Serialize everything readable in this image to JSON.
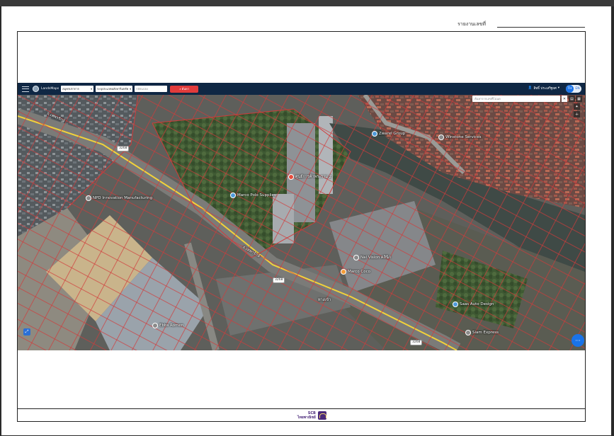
{
  "report": {
    "label": "รายงานเลขที่",
    "value": ""
  },
  "nav": {
    "brand": "LandsMaps",
    "province_value": "สมุทรปราการ",
    "district_value": "ระบุประเภทอสังหาริมทรัพย์",
    "parcel_placeholder": "รหัสแปลง",
    "search_label": "ค้นหา",
    "user_name": "สิทธิ์ ประเสริฐยศ",
    "lang": [
      "TH",
      "EN"
    ]
  },
  "map_search": {
    "placeholder": "ค้นหาจากเลขที่โฉนด"
  },
  "places": [
    {
      "name": "Marco Polo Supplies",
      "color": "#4e9ad9"
    },
    {
      "name": "ศูนย์การค้าพระราม 2",
      "color": "#e74c3c"
    },
    {
      "name": "NPD Innovation Manufacturing",
      "color": "#8a8a8a"
    },
    {
      "name": "Zwarel Group",
      "color": "#4e9ad9"
    },
    {
      "name": "Winstone Services",
      "color": "#8a8a8a"
    },
    {
      "name": "Ebbs Romen",
      "color": "#8a8a8a"
    },
    {
      "name": "Saas Auto Design",
      "color": "#4e9ad9"
    },
    {
      "name": "Siam Express",
      "color": "#8a8a8a"
    },
    {
      "name": "Nai Vision คลินิก",
      "color": "#8a8a8a"
    },
    {
      "name": "Marco Coco",
      "color": "#f39c37"
    }
  ],
  "roads": [
    {
      "label": "ถ.เทพารักษ์"
    },
    {
      "label": "ถ.เทพารักษ์"
    },
    {
      "label": "ทางเข้า"
    }
  ],
  "shields": [
    "3268",
    "3268",
    "3268"
  ],
  "footer": {
    "bank_line1": "SCB",
    "bank_line2": "ไทยพาณิชย์"
  },
  "colors": {
    "nav_bg": "#0f2744",
    "search_btn": "#e23b3b",
    "parcel_border": "#d23a3a",
    "road": "#f2d23a"
  },
  "icons": [
    "menu-icon",
    "search-icon",
    "user-icon",
    "close-icon",
    "layers-icon",
    "plus-icon",
    "more-icon"
  ]
}
